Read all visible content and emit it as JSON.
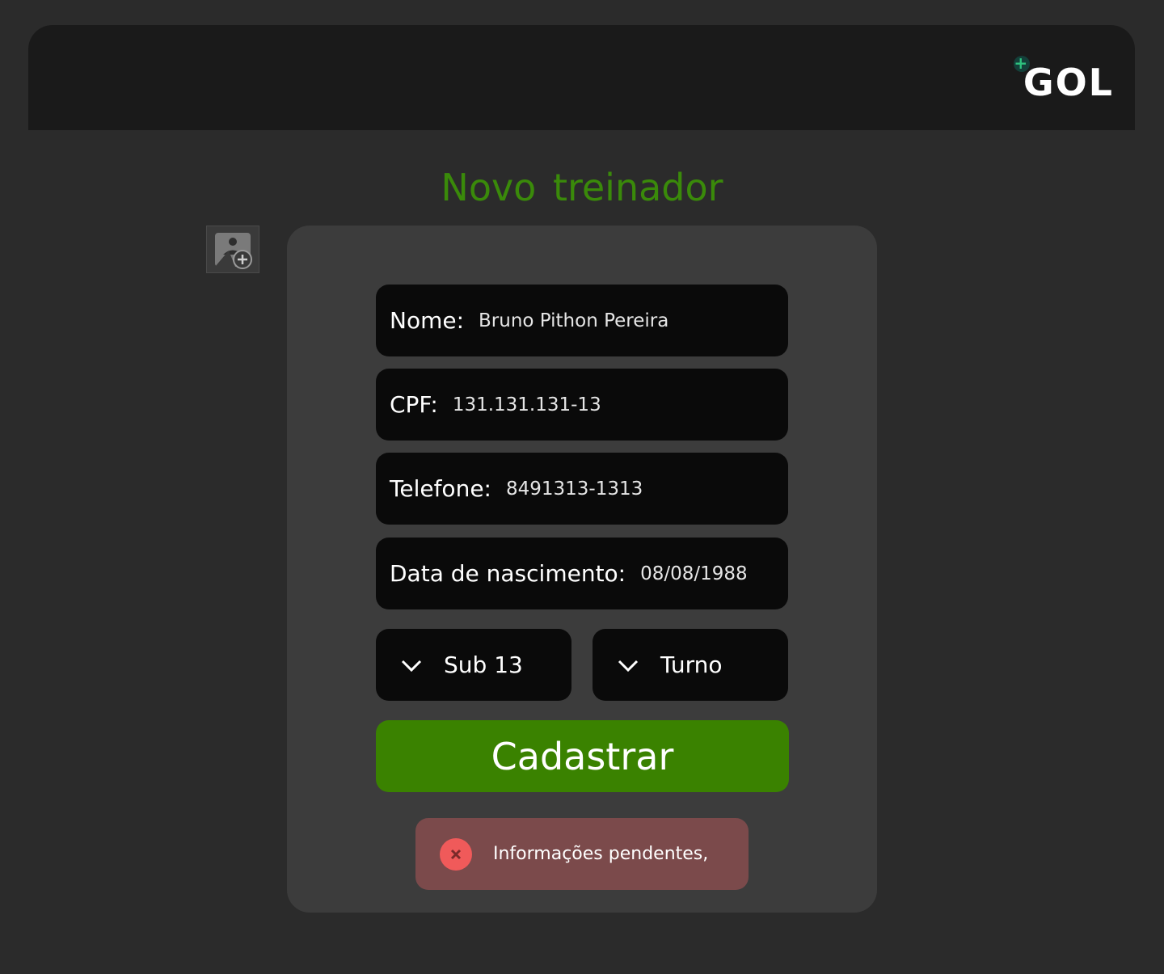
{
  "header": {
    "logo_text": "GOL",
    "logo_plus": "+"
  },
  "page": {
    "title": "Novo treinador"
  },
  "photo": {
    "icon": "add-photo-icon"
  },
  "form": {
    "name": {
      "label": "Nome:",
      "value": "Bruno Pithon Pereira"
    },
    "cpf": {
      "label": "CPF:",
      "value": "131.131.131-13"
    },
    "phone": {
      "label": "Telefone:",
      "value": "8491313-1313"
    },
    "birth": {
      "label": "Data de nascimento:",
      "value": "08/08/1988"
    },
    "category": {
      "value": "Sub 13",
      "icon": "chevron-down-icon"
    },
    "shift": {
      "value": "Turno",
      "icon": "chevron-down-icon"
    },
    "submit_label": "Cadastrar"
  },
  "toast": {
    "message": "Informações pendentes,",
    "icon": "error-icon"
  },
  "colors": {
    "accent": "#3a8200",
    "title": "#3a8a0a",
    "error_bg": "#7b4a4b",
    "error_icon": "#f05a5a"
  }
}
